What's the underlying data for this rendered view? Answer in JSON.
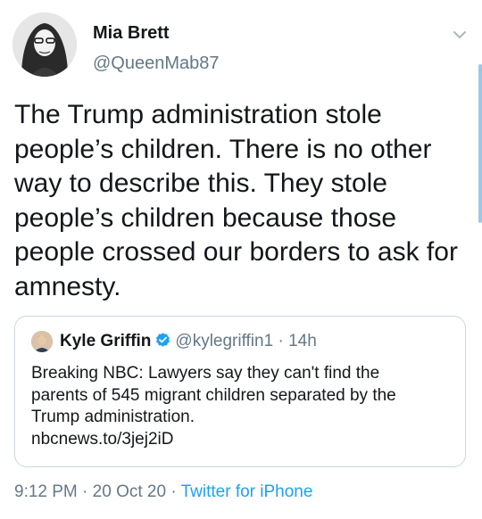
{
  "author": {
    "name": "Mia Brett",
    "handle": "@QueenMab87"
  },
  "tweet": {
    "lines": [
      "The Trump administration stole",
      "people’s children. There is no other",
      "way to describe this. They stole",
      "people’s children because those",
      "people crossed our borders to ask for",
      "amnesty."
    ]
  },
  "quoted_tweet": {
    "name": "Kyle Griffin",
    "handle": "@kylegriffin1",
    "separator": "·",
    "time": "14h",
    "verified": true,
    "lines": [
      "Breaking NBC: Lawyers say they can't find the",
      "parents of 545 migrant children separated by the",
      "Trump administration.",
      "nbcnews.to/3jej2iD"
    ]
  },
  "meta": {
    "time": "9:12 PM",
    "sep1": "·",
    "date": "20 Oct 20",
    "sep2": "·",
    "source": "Twitter for iPhone"
  },
  "icons": {
    "menu": "chevron-down-icon",
    "verified": "verified-badge-icon"
  },
  "colors": {
    "text": "#14171a",
    "secondary": "#657786",
    "link": "#1da1f2",
    "border": "#ccd6dd"
  }
}
